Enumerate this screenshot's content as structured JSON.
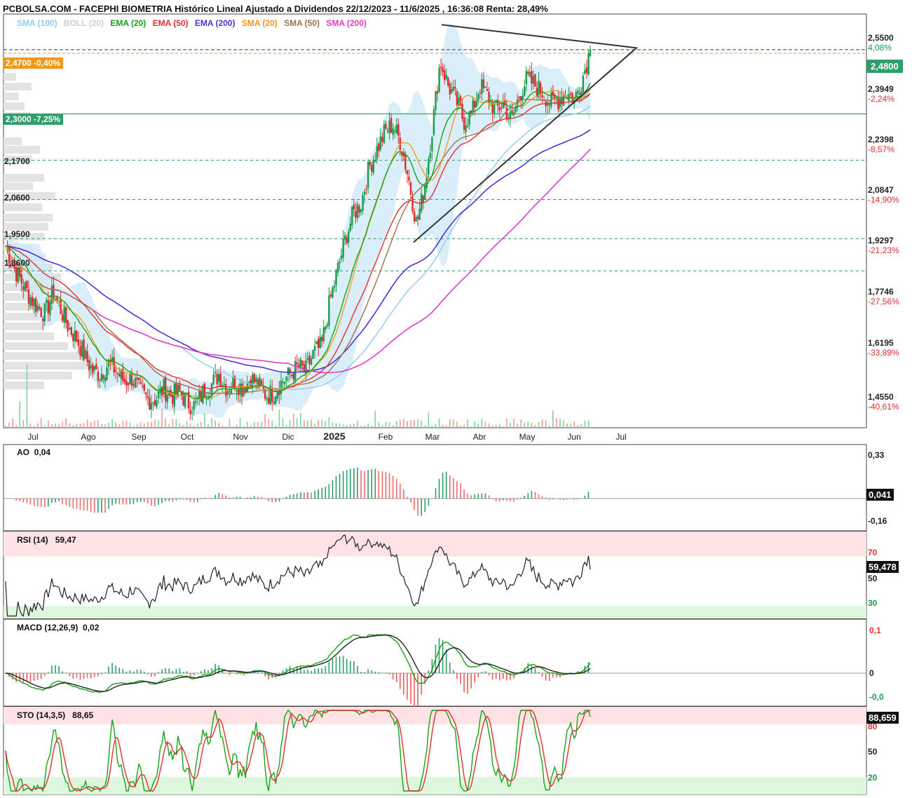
{
  "header": {
    "title": "PCBOLSA.COM - FACEPHI BIOMETRIA Histórico Lineal Ajustado a Dividendos 22/12/2023 - 11/6/2025 , 16:36:08 Renta: 28,49%"
  },
  "legend": [
    {
      "label": "SMA (100)",
      "color": "#8fcdf0"
    },
    {
      "label": "BOLL (20)",
      "color": "#cfcfcf"
    },
    {
      "label": "EMA (20)",
      "color": "#17a317"
    },
    {
      "label": "EMA (50)",
      "color": "#e03030"
    },
    {
      "label": "EMA (200)",
      "color": "#4b33d8"
    },
    {
      "label": "SMA (20)",
      "color": "#f0981a"
    },
    {
      "label": "SMA (50)",
      "color": "#a0714a"
    },
    {
      "label": "SMA (200)",
      "color": "#e03cc8"
    }
  ],
  "price_labels": {
    "current_left": "2,4700 -0,40%",
    "support_left": "2,3000 -7,25%",
    "current_right": "2,4800"
  },
  "horizontal_levels": [
    "2,1700",
    "2,0600",
    "1,9500",
    "1,8600"
  ],
  "price_axis": [
    {
      "price": "2,5500",
      "pct": "4,08%",
      "pct_color": "#1a9a4a"
    },
    {
      "price": "2,3949",
      "pct": "-2,24%",
      "pct_color": "#e03030"
    },
    {
      "price": "2,2398",
      "pct": "-8,57%",
      "pct_color": "#e03030"
    },
    {
      "price": "2,0847",
      "pct": "-14,90%",
      "pct_color": "#e03030"
    },
    {
      "price": "1,9297",
      "pct": "-21,23%",
      "pct_color": "#e03030"
    },
    {
      "price": "1,7746",
      "pct": "-27,56%",
      "pct_color": "#e03030"
    },
    {
      "price": "1,6195",
      "pct": "-33,89%",
      "pct_color": "#e03030"
    },
    {
      "price": "1,4550",
      "pct": "-40,61%",
      "pct_color": "#e03030"
    }
  ],
  "months": [
    "Jul",
    "Ago",
    "Sep",
    "Oct",
    "Nov",
    "Dic",
    "2025",
    "Feb",
    "Mar",
    "Abr",
    "May",
    "Jun",
    "Jul"
  ],
  "panels": {
    "ao": {
      "title": "AO",
      "value": "0,04",
      "axis": [
        "0,33",
        "-0,16"
      ],
      "box": "0,041"
    },
    "rsi": {
      "title": "RSI (14)",
      "value": "59,47",
      "axis": [
        "70",
        "50",
        "30"
      ],
      "box": "59,478"
    },
    "macd": {
      "title": "MACD (12,26,9)",
      "value": "0,02",
      "axis": [
        "0,1",
        "0",
        "-0,0"
      ]
    },
    "sto": {
      "title": "STO (14,3,5)",
      "value": "88,65",
      "axis": [
        "80",
        "50",
        "20"
      ],
      "box": "88,659"
    }
  },
  "chart_data": [
    {
      "type": "candlestick",
      "title": "PCBOLSA.COM - FACEPHI BIOMETRIA Histórico Lineal Ajustado a Dividendos 22/12/2023 - 11/6/2025 , 16:36:08 Renta: 28,49%",
      "x_ticks": [
        "Jul",
        "Ago",
        "Sep",
        "Oct",
        "Nov",
        "Dic",
        "2025",
        "Feb",
        "Mar",
        "Abr",
        "May",
        "Jun",
        "Jul"
      ],
      "ylim": [
        1.42,
        2.58
      ],
      "last_close": 2.48,
      "close_trajectory": [
        1.93,
        1.87,
        1.83,
        1.79,
        1.76,
        1.74,
        1.8,
        1.75,
        1.7,
        1.67,
        1.62,
        1.58,
        1.57,
        1.6,
        1.58,
        1.55,
        1.56,
        1.52,
        1.5,
        1.5,
        1.53,
        1.51,
        1.52,
        1.49,
        1.48,
        1.52,
        1.54,
        1.57,
        1.53,
        1.55,
        1.53,
        1.56,
        1.54,
        1.51,
        1.52,
        1.55,
        1.57,
        1.59,
        1.58,
        1.63,
        1.65,
        1.77,
        1.86,
        1.95,
        2.02,
        2.05,
        2.15,
        2.2,
        2.25,
        2.27,
        2.22,
        2.12,
        1.99,
        2.09,
        2.26,
        2.45,
        2.38,
        2.34,
        2.28,
        2.3,
        2.38,
        2.35,
        2.31,
        2.33,
        2.28,
        2.35,
        2.4,
        2.38,
        2.36,
        2.33,
        2.34,
        2.36,
        2.34,
        2.4,
        2.48
      ],
      "overlays": [
        "SMA (100)",
        "BOLL (20)",
        "EMA (20)",
        "EMA (50)",
        "EMA (200)",
        "SMA (20)",
        "SMA (50)",
        "SMA (200)"
      ],
      "levels": [
        2.47,
        2.3,
        2.17,
        2.06,
        1.95,
        1.86
      ]
    },
    {
      "type": "bar",
      "title": "AO",
      "last_value": 0.041,
      "ylim": [
        -0.16,
        0.33
      ]
    },
    {
      "type": "line",
      "title": "RSI (14)",
      "last_value": 59.478,
      "levels": [
        70,
        30
      ]
    },
    {
      "type": "line",
      "title": "MACD (12,26,9)",
      "last_value": 0.02
    },
    {
      "type": "line",
      "title": "STO (14,3,5)",
      "last_value": 88.659,
      "levels": [
        80,
        20
      ]
    }
  ]
}
